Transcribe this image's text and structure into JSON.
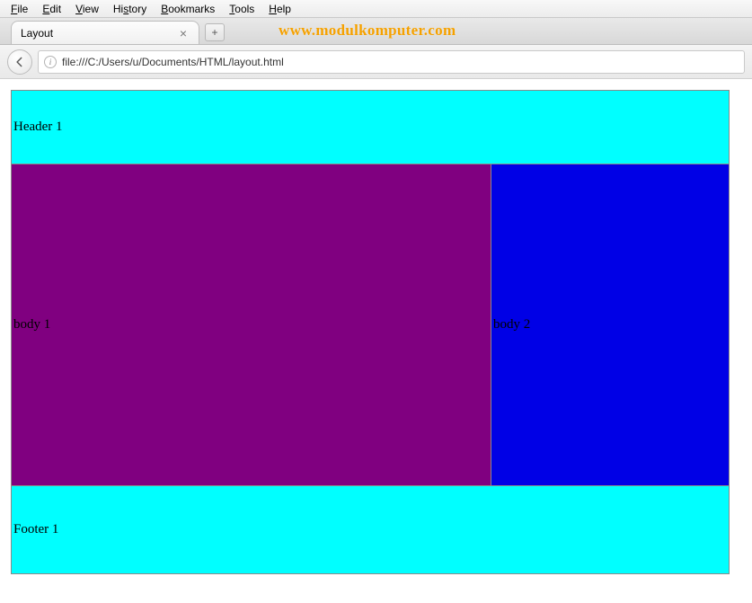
{
  "menubar": {
    "items": [
      {
        "label": "File",
        "hotkey_index": 0
      },
      {
        "label": "Edit",
        "hotkey_index": 0
      },
      {
        "label": "View",
        "hotkey_index": 0
      },
      {
        "label": "History",
        "hotkey_index": 2
      },
      {
        "label": "Bookmarks",
        "hotkey_index": 0
      },
      {
        "label": "Tools",
        "hotkey_index": 0
      },
      {
        "label": "Help",
        "hotkey_index": 0
      }
    ]
  },
  "tabs": {
    "active": {
      "title": "Layout"
    },
    "newtab_glyph": "+"
  },
  "watermark": "www.modulkomputer.com",
  "addressbar": {
    "url": "file:///C:/Users/u/Documents/HTML/layout.html",
    "info_glyph": "i"
  },
  "page": {
    "header": "Header 1",
    "body1": "body 1",
    "body2": "body 2",
    "footer": "Footer 1"
  },
  "colors": {
    "header_bg": "#00ffff",
    "body1_bg": "#800080",
    "body2_bg": "#0000e6",
    "footer_bg": "#00ffff"
  }
}
